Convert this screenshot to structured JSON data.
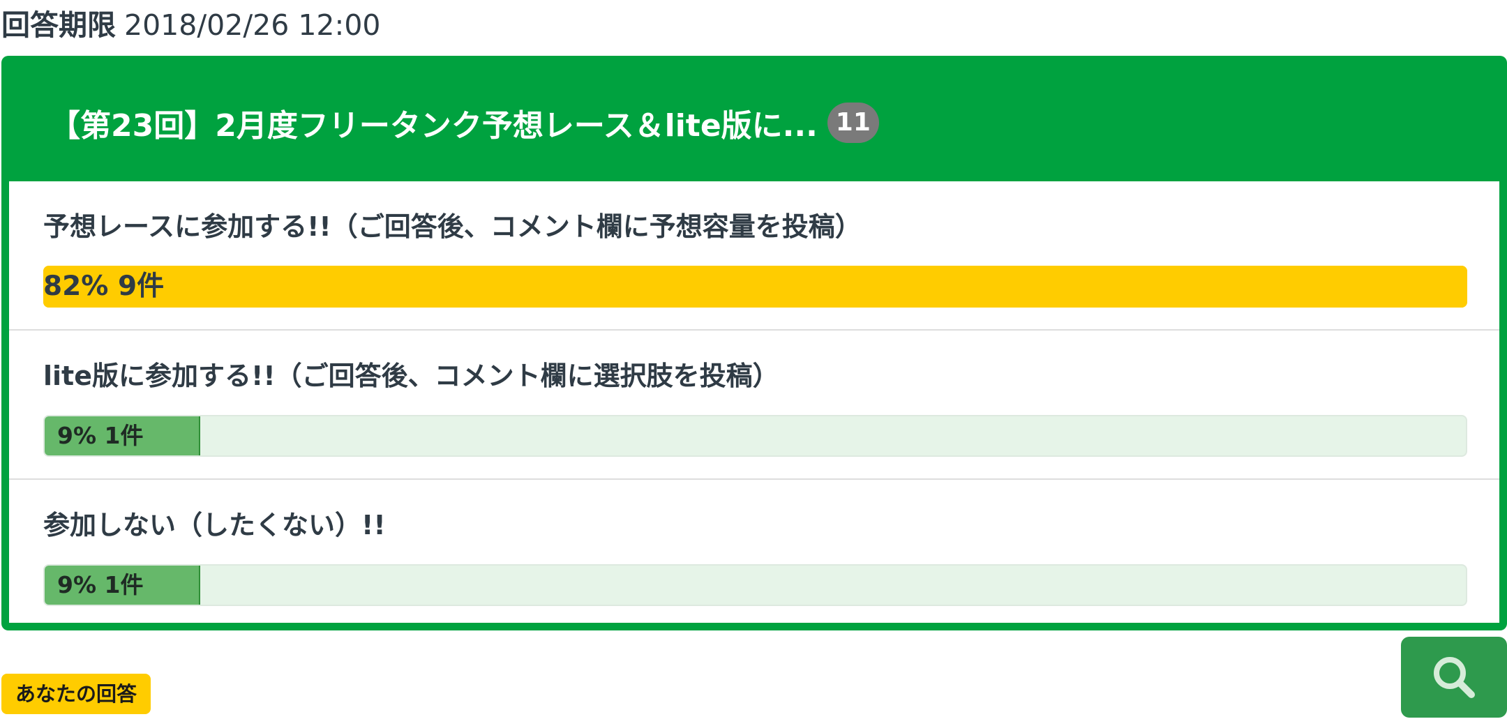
{
  "deadline": {
    "label": "回答期限",
    "value": "2018/02/26 12:00"
  },
  "poll": {
    "title": "【第23回】2月度フリータンク予想レース＆lite版に...",
    "response_count": "11",
    "options": [
      {
        "label": "予想レースに参加する!!（ご回答後、コメント欄に予想容量を投稿）",
        "percent_text": "82%",
        "count_text": "9件",
        "percent": 82,
        "is_top": true
      },
      {
        "label": "lite版に参加する!!（ご回答後、コメント欄に選択肢を投稿）",
        "percent_text": "9%",
        "count_text": "1件",
        "percent": 9,
        "is_top": false
      },
      {
        "label": "参加しない（したくない）!!",
        "percent_text": "9%",
        "count_text": "1件",
        "percent": 9,
        "is_top": false
      }
    ]
  },
  "your_answer_label": "あなたの回答",
  "search_icon": "search-icon",
  "colors": {
    "header_green": "#00a23f",
    "top_bar_yellow": "#ffcc00",
    "bar_green": "#66b86a",
    "bar_track": "#e6f4e8",
    "badge_gray": "#7a7a7a",
    "search_button_green": "#2e9a4d"
  }
}
